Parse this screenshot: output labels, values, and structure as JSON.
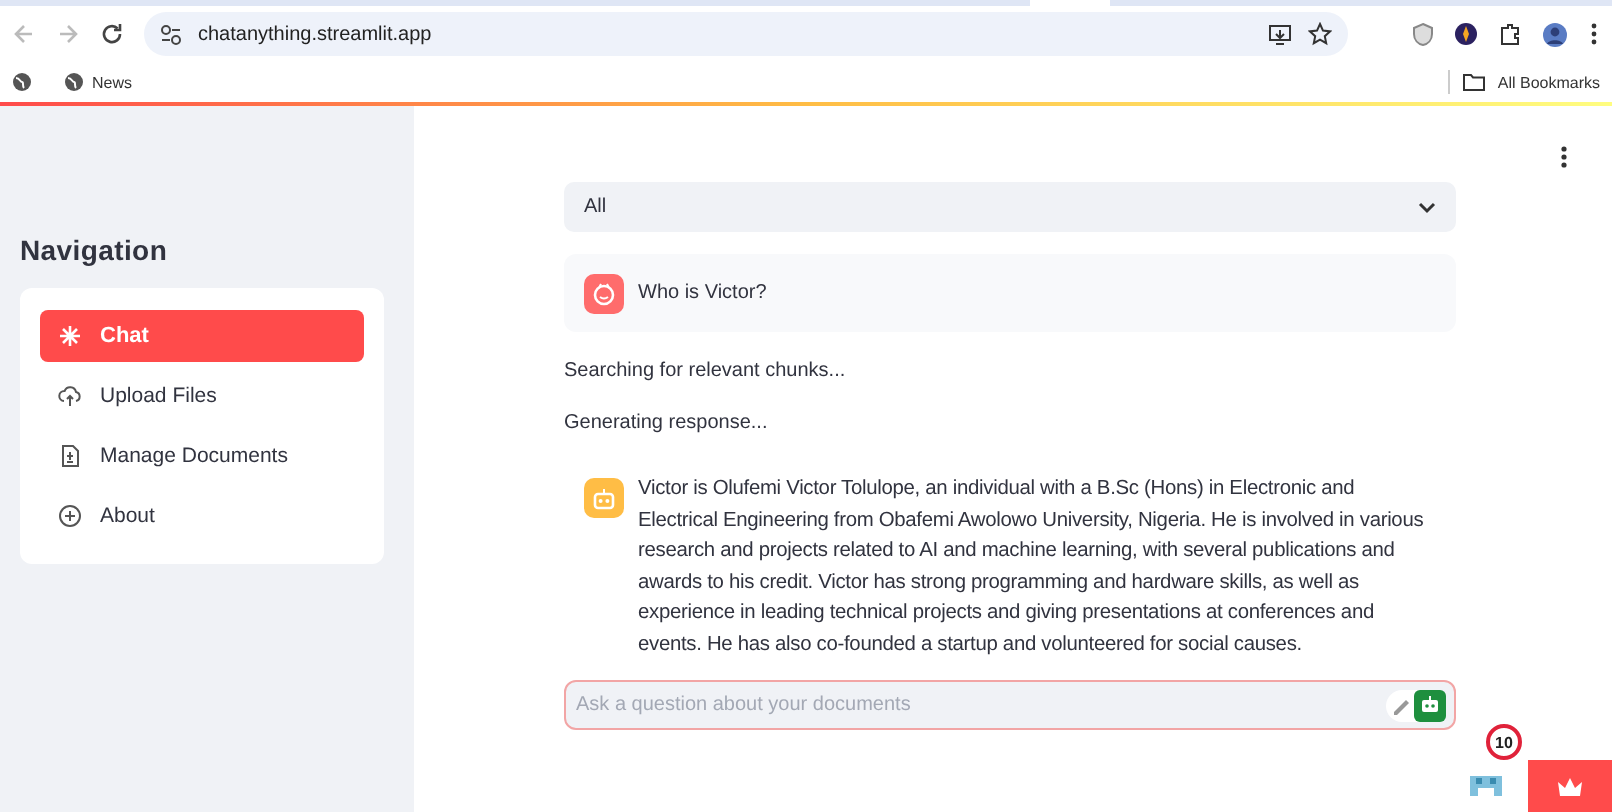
{
  "browser": {
    "url": "chatanything.streamlit.app",
    "bookmarks": [
      {
        "label": "News"
      }
    ],
    "all_bookmarks": "All Bookmarks"
  },
  "sidebar": {
    "title": "Navigation",
    "items": [
      {
        "label": "Chat",
        "selected": true
      },
      {
        "label": "Upload Files",
        "selected": false
      },
      {
        "label": "Manage Documents",
        "selected": false
      },
      {
        "label": "About",
        "selected": false
      }
    ]
  },
  "main": {
    "filter": {
      "value": "All"
    },
    "messages": [
      {
        "kind": "user",
        "text": "Who is Victor?"
      },
      {
        "kind": "status",
        "text": "Searching for relevant chunks..."
      },
      {
        "kind": "status",
        "text": "Generating response..."
      },
      {
        "kind": "assistant",
        "text": "Victor is Olufemi Victor Tolulope, an individual with a B.Sc (Hons) in Electronic and Electrical Engineering from Obafemi Awolowo University, Nigeria. He is involved in various research and projects related to AI and machine learning, with several publications and awards to his credit. Victor has strong programming and hardware skills, as well as experience in leading technical projects and giving presentations at conferences and events. He has also co-founded a startup and volunteered for social causes."
      }
    ],
    "chat_input": {
      "placeholder": "Ask a question about your documents"
    },
    "notification_count": "10"
  }
}
